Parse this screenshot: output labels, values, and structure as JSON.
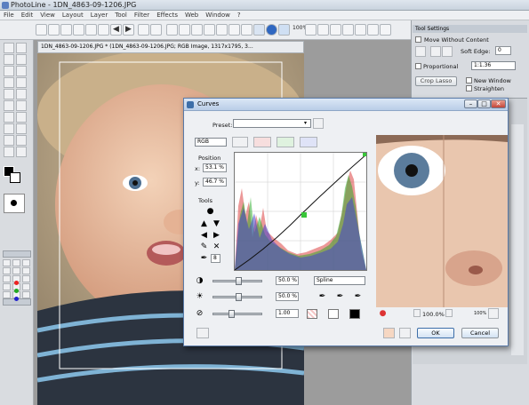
{
  "app": {
    "title": "PhotoLine - 1DN_4863-09-1206.JPG"
  },
  "menu": [
    "File",
    "Edit",
    "View",
    "Layout",
    "Layer",
    "Tool",
    "Filter",
    "Effects",
    "Web",
    "Window",
    "?"
  ],
  "toolbar": {
    "zoom": "100%"
  },
  "document": {
    "tab": "1DN_4863-09-1206.JPG * (1DN_4863-09-1206.JPG; RGB Image, 1317x1795, 3..."
  },
  "tool_settings": {
    "title": "Tool Settings",
    "move_without_content": "Move Without Content",
    "soft_edge_label": "Soft Edge:",
    "soft_edge_value": "0",
    "proportional": "Proportional",
    "ratio": "1:1.36",
    "crop_lasso": "Crop Lasso",
    "new_window": "New Window",
    "straighten": "Straighten"
  },
  "curves": {
    "title": "Curves",
    "preset_label": "Preset:",
    "preset_value": "",
    "channel": "RGB",
    "position_label": "Position",
    "x_label": "x:",
    "x_value": "53.1 %",
    "y_label": "y:",
    "y_value": "46.7 %",
    "tools_label": "Tools",
    "tool_size": "8",
    "slider1_value": "50.0 %",
    "slider2_value": "50.0 %",
    "slider3_value": "1.00",
    "interpolation": "Spline",
    "preview_zoom": "100.0%",
    "zoom_small": "100%",
    "ok": "OK",
    "cancel": "Cancel",
    "colors": {
      "accent": "#3d6ea8",
      "curve_point": "#39c639"
    }
  }
}
